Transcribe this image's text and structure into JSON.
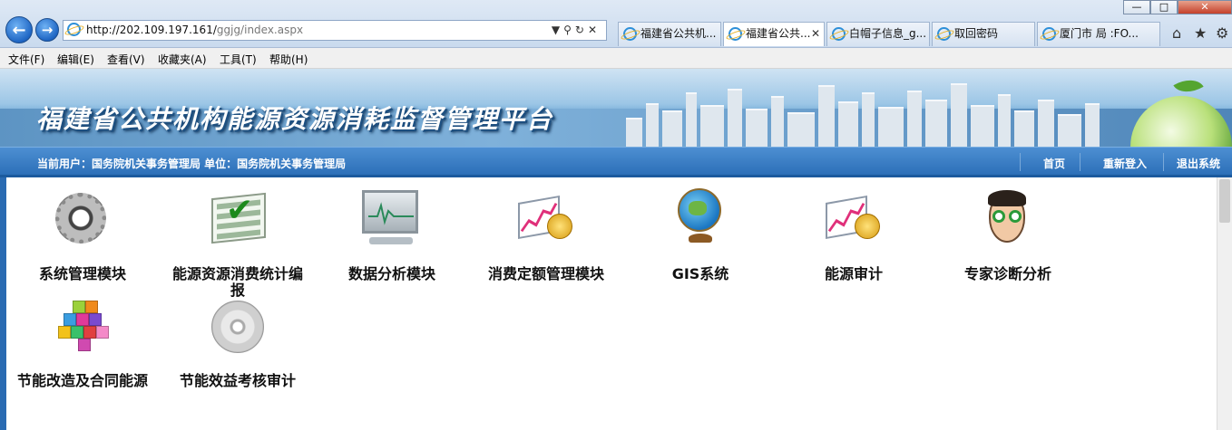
{
  "browser": {
    "url_host": "http://202.109.197.161/",
    "url_path": "ggjg/index.aspx",
    "tabs": [
      {
        "label": "福建省公共机..."
      },
      {
        "label": "福建省公共..."
      },
      {
        "label": "白帽子信息_g..."
      },
      {
        "label": "取回密码"
      },
      {
        "label": "厦门市 局 :FO..."
      }
    ],
    "menu": [
      "文件(F)",
      "编辑(E)",
      "查看(V)",
      "收藏夹(A)",
      "工具(T)",
      "帮助(H)"
    ]
  },
  "banner": {
    "title": "福建省公共机构能源资源消耗监督管理平台"
  },
  "userbar": {
    "info": "当前用户：国务院机关事务管理局  单位：国务院机关事务管理局",
    "links": [
      "首页",
      "重新登入",
      "退出系统"
    ]
  },
  "modules": [
    {
      "label": "系统管理模块",
      "icon": "gear-icon"
    },
    {
      "label": "能源资源消费统计编报",
      "icon": "checklist-icon"
    },
    {
      "label": "数据分析模块",
      "icon": "monitor-icon"
    },
    {
      "label": "消费定额管理模块",
      "icon": "chart-coins-icon"
    },
    {
      "label": "GIS系统",
      "icon": "globe-icon"
    },
    {
      "label": "能源审计",
      "icon": "chart-coins-icon"
    },
    {
      "label": "专家诊断分析",
      "icon": "expert-icon"
    },
    {
      "label": "节能改造及合同能源",
      "icon": "cubes-icon"
    },
    {
      "label": "节能效益考核审计",
      "icon": "cd-icon"
    }
  ],
  "colors": {
    "userbar": "#2c6fb8",
    "content_border": "#2a6bb2"
  }
}
